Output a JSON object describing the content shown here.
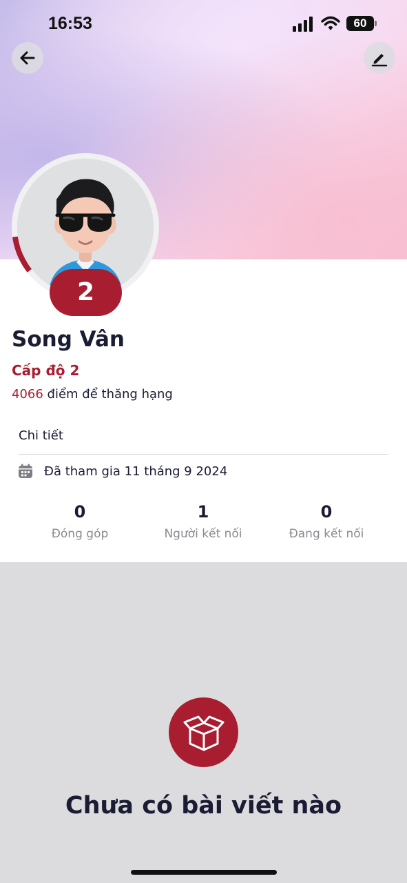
{
  "status_bar": {
    "time": "16:53",
    "battery": "60",
    "icons": [
      "signal-icon",
      "wifi-icon",
      "battery-icon"
    ]
  },
  "header": {
    "back_icon": "arrow-left-icon",
    "edit_icon": "pencil-icon"
  },
  "profile": {
    "level_badge": "2",
    "name": "Song Vân",
    "level_label": "Cấp độ 2",
    "points_value": "4066",
    "points_suffix": " điểm để thăng hạng",
    "level_progress": 0.083
  },
  "details": {
    "title": "Chi tiết",
    "joined_icon": "calendar-icon",
    "joined_text": "Đã tham gia 11 tháng 9 2024"
  },
  "stats": [
    {
      "value": "0",
      "label": "Đóng góp"
    },
    {
      "value": "1",
      "label": "Người kết nối"
    },
    {
      "value": "0",
      "label": "Đang kết nối"
    }
  ],
  "empty_state": {
    "icon": "box-icon",
    "title": "Chưa có bài viết nào"
  },
  "colors": {
    "accent": "#a91d31",
    "text": "#1a1c33",
    "muted": "#8a8a92",
    "background": "#dcdcde"
  }
}
